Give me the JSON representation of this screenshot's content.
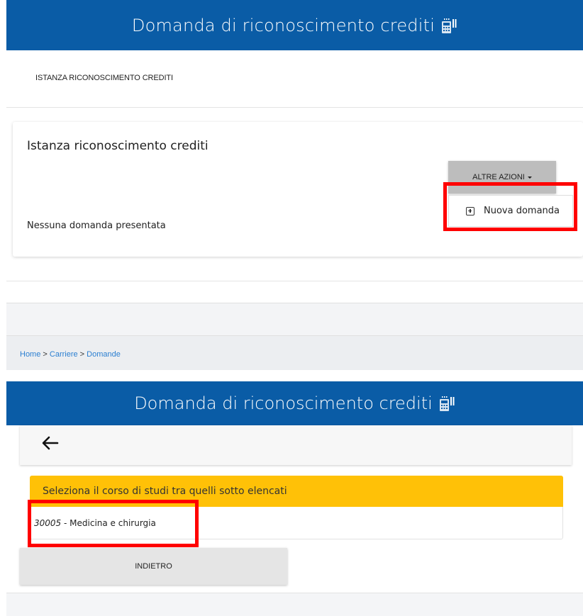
{
  "top": {
    "header_title": "Domanda di riconoscimento crediti",
    "header_icon": "calculator-icon",
    "subtitle": "ISTANZA RICONOSCIMENTO CREDITI",
    "card": {
      "title": "Istanza riconoscimento crediti",
      "empty_message": "Nessuna domanda presentata",
      "actions_button": "ALTRE AZIONI",
      "dropdown_item": "Nuova domanda",
      "dropdown_icon": "plus-square-icon"
    }
  },
  "bottom": {
    "breadcrumb": {
      "home": "Home",
      "sep1": " > ",
      "carriere": "Carriere",
      "sep2": " > ",
      "domande": "Domande"
    },
    "header_title": "Domanda di riconoscimento crediti",
    "back_icon": "arrow-left-icon",
    "select_header": "Seleziona il corso di studi tra quelli sotto elencati",
    "course": {
      "code": "30005",
      "separator": " - ",
      "name": "Medicina e chirurgia"
    },
    "back_button": "INDIETRO"
  },
  "colors": {
    "header_blue": "#0a5ca6",
    "highlight_red": "#ff0000",
    "panel_yellow": "#ffc107",
    "link_blue": "#2b7fd1"
  }
}
